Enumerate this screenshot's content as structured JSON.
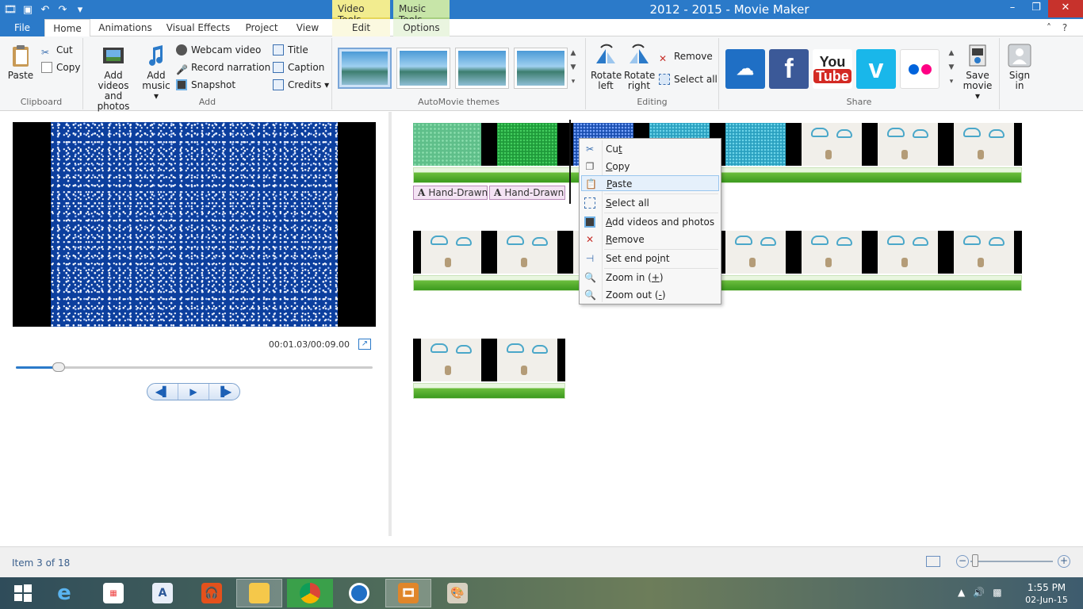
{
  "window": {
    "title": "2012 - 2015 - Movie Maker",
    "qat_icons": [
      "movie-maker-app-icon",
      "save-icon",
      "undo-icon",
      "redo-icon",
      "customize-qat-icon"
    ],
    "controls": {
      "minimize": "–",
      "maximize": "❐",
      "close": "✕"
    }
  },
  "context_tabs": {
    "video_tools": "Video Tools",
    "music_tools": "Music Tools"
  },
  "tabs": {
    "file": "File",
    "home": "Home",
    "animations": "Animations",
    "visual_effects": "Visual Effects",
    "project": "Project",
    "view": "View",
    "edit": "Edit",
    "options": "Options"
  },
  "ribbon": {
    "clipboard": {
      "label": "Clipboard",
      "paste": "Paste",
      "cut": "Cut",
      "copy": "Copy"
    },
    "add": {
      "label": "Add",
      "add_videos_line1": "Add videos",
      "add_videos_line2": "and photos",
      "add_music_line1": "Add",
      "add_music_line2": "music ▾",
      "webcam": "Webcam video",
      "narration": "Record narration ▾",
      "snapshot": "Snapshot",
      "title": "Title",
      "caption": "Caption",
      "credits": "Credits ▾"
    },
    "automovie": {
      "label": "AutoMovie themes"
    },
    "editing": {
      "label": "Editing",
      "rotate_left_line1": "Rotate",
      "rotate_left_line2": "left",
      "rotate_right_line1": "Rotate",
      "rotate_right_line2": "right",
      "remove": "Remove",
      "select_all": "Select all"
    },
    "share": {
      "label": "Share",
      "save_movie_line1": "Save",
      "save_movie_line2": "movie ▾",
      "services": [
        "OneDrive",
        "Facebook",
        "YouTube",
        "Vimeo",
        "Flickr"
      ],
      "youtube_you": "You",
      "youtube_tube": "Tube",
      "facebook_f": "f",
      "vimeo_v": "v"
    },
    "signin": {
      "line1": "Sign",
      "line2": "in"
    }
  },
  "preview": {
    "timecode": "00:01.03/00:09.00",
    "progress_fraction": 0.12
  },
  "storyboard": {
    "caption_chip_label": "Hand-Drawn"
  },
  "context_menu": {
    "cut_before": "Cu",
    "cut_u": "t",
    "cut_after": "",
    "copy_before": "",
    "copy_u": "C",
    "copy_after": "opy",
    "paste_before": "",
    "paste_u": "P",
    "paste_after": "aste",
    "select_all_before": "",
    "select_all_u": "S",
    "select_all_after": "elect all",
    "add_videos_before": "",
    "add_videos_u": "A",
    "add_videos_after": "dd videos and photos",
    "remove_before": "",
    "remove_u": "R",
    "remove_after": "emove",
    "set_end_before": "Set end po",
    "set_end_u": "i",
    "set_end_after": "nt",
    "zoom_in_before": "Zoom in (",
    "zoom_in_u": "+",
    "zoom_in_after": ")",
    "zoom_out_before": "Zoom out (",
    "zoom_out_u": "-",
    "zoom_out_after": ")"
  },
  "status": {
    "item_text": "Item 3 of 18"
  },
  "taskbar": {
    "apps": [
      "Internet Explorer",
      "Apps",
      "Word",
      "Headphones",
      "File Explorer",
      "Chrome",
      "Music",
      "Movie Maker",
      "Paint"
    ],
    "time": "1:55 PM",
    "date": "02-Jun-15"
  }
}
